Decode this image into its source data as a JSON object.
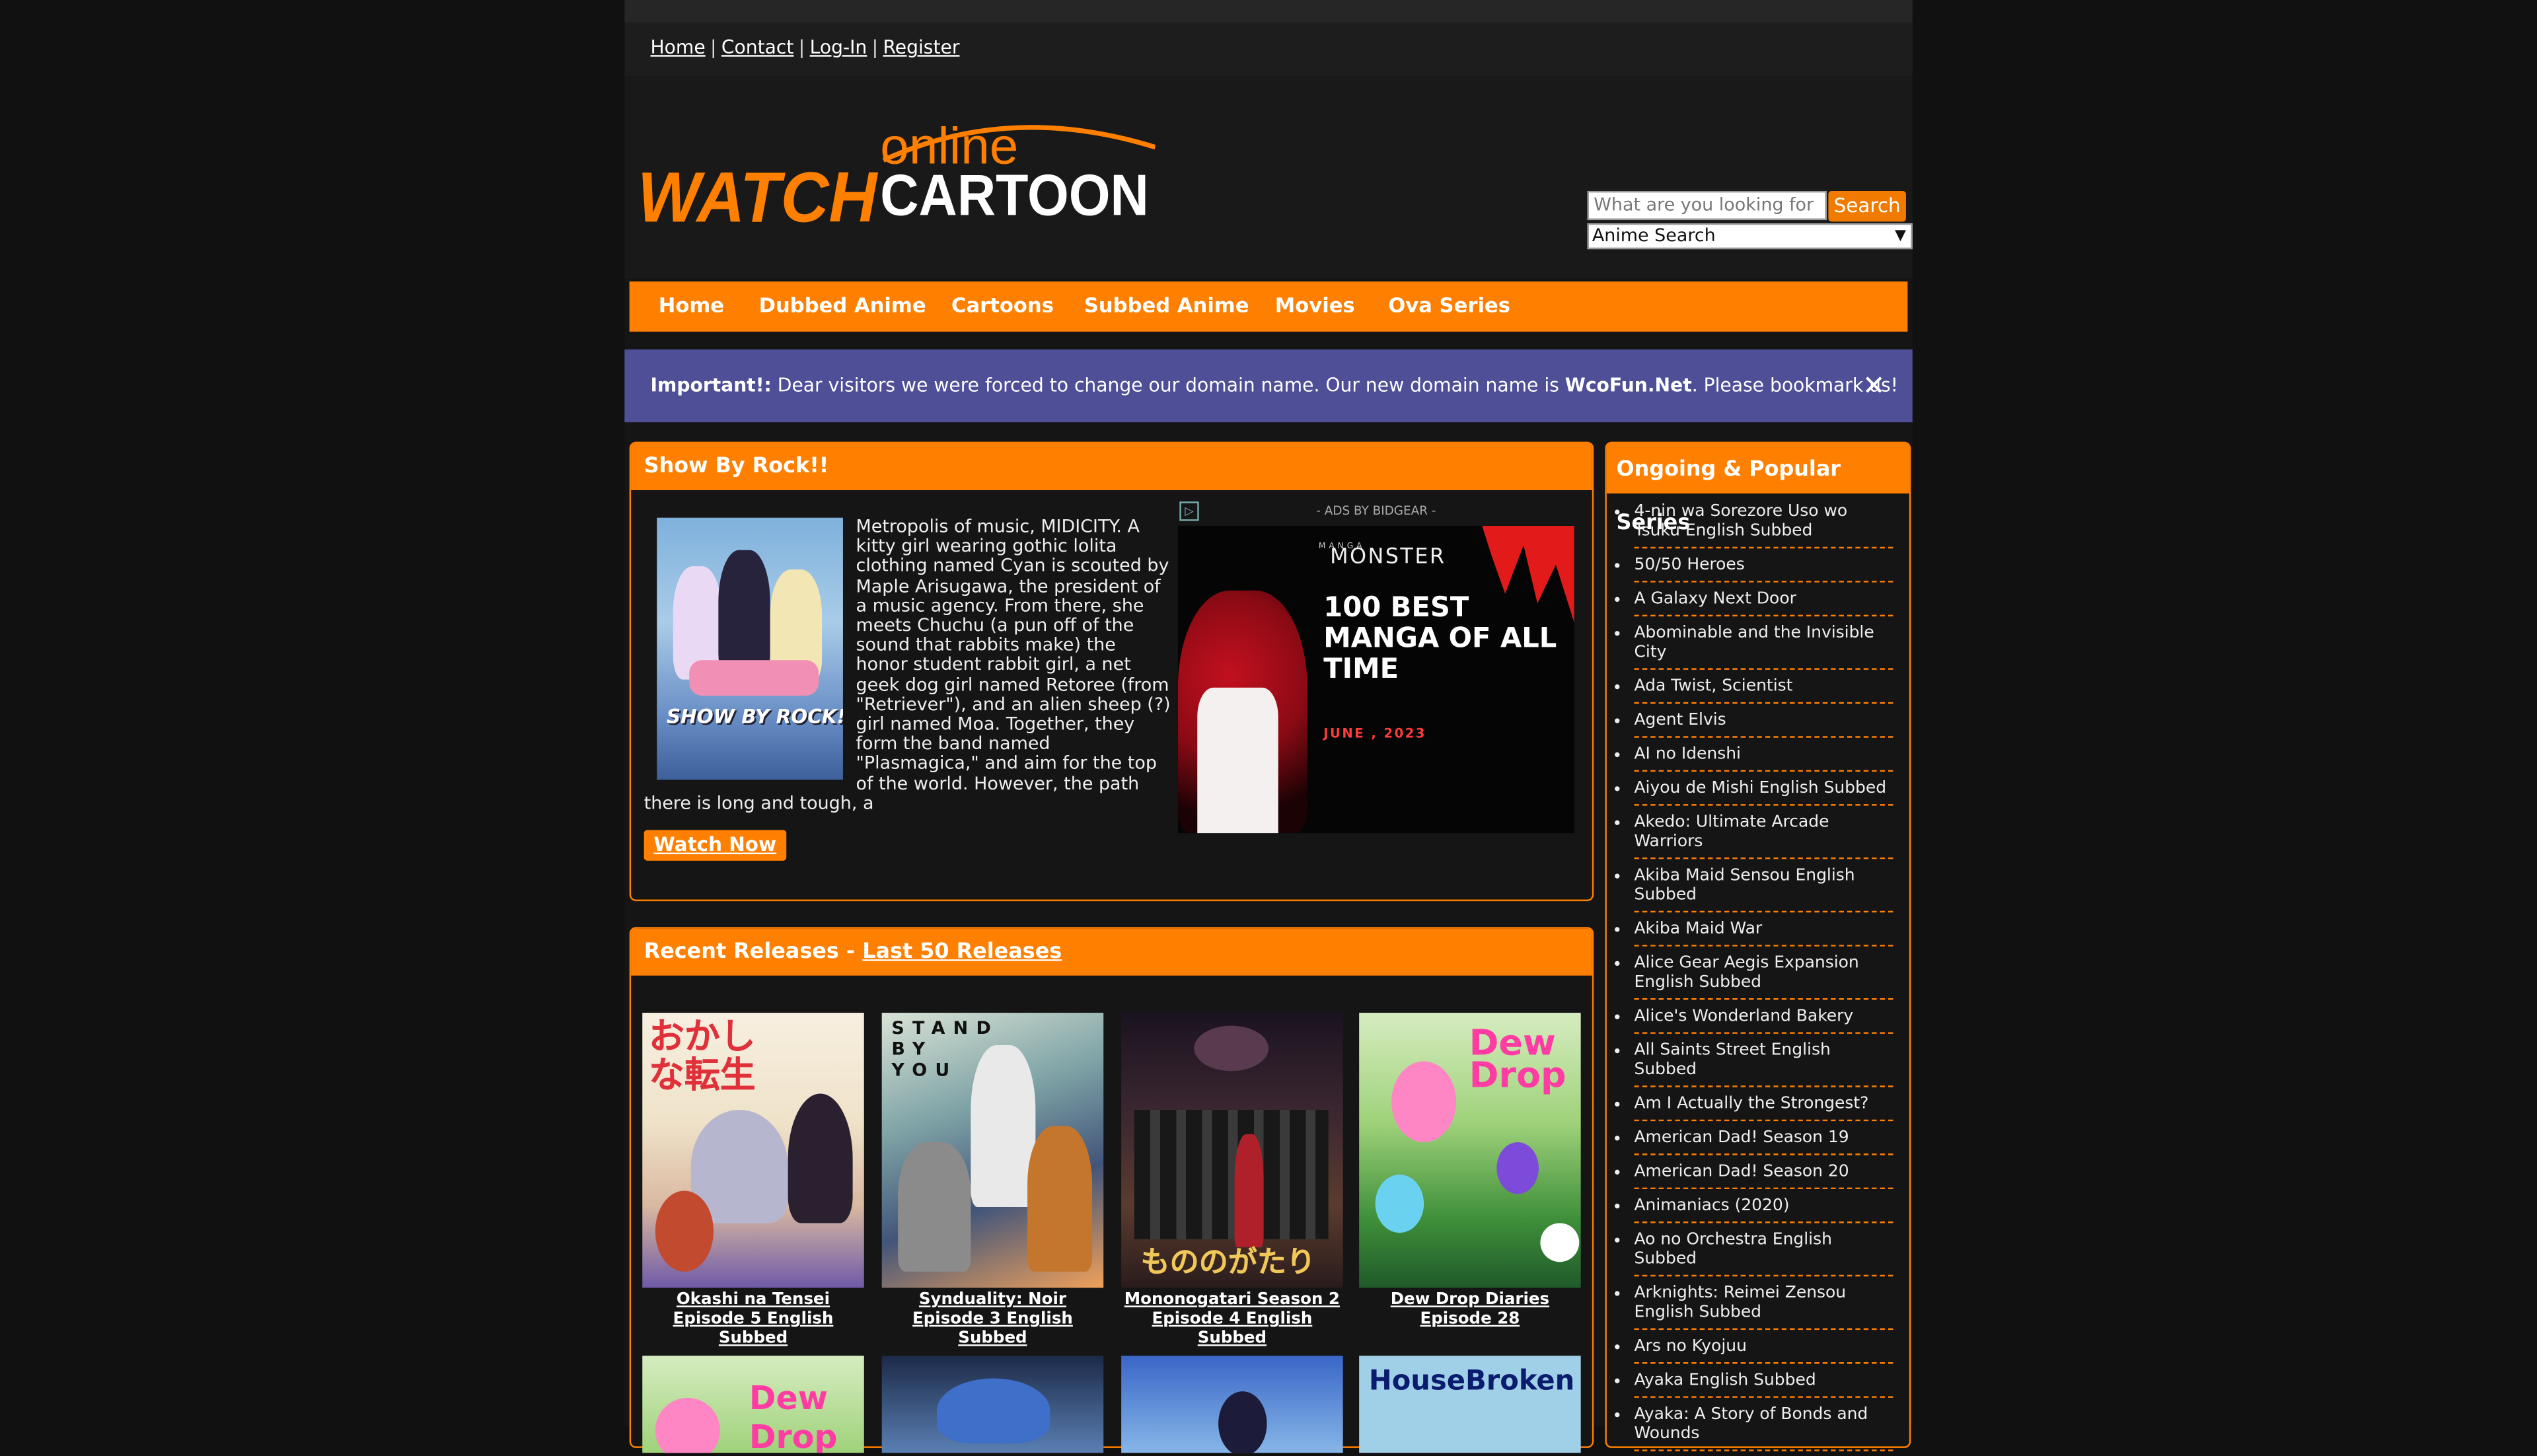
{
  "toplinks": {
    "home": "Home",
    "contact": "Contact",
    "login": "Log-In",
    "register": "Register",
    "sep": "|"
  },
  "logo": {
    "top": "online",
    "left": "WATCH",
    "right": "CARTOON"
  },
  "search": {
    "placeholder": "What are you looking for",
    "button": "Search",
    "select": "Anime Search"
  },
  "nav": [
    "Home",
    "Dubbed Anime",
    "Cartoons",
    "Subbed Anime",
    "Movies",
    "Ova Series"
  ],
  "notice": {
    "label": "Important!:",
    "text": " Dear visitors we were forced to change our domain name. Our new domain name is ",
    "domain": "WcoFun.Net",
    "tail": ". Please bookmark us!",
    "close": "✕"
  },
  "featured": {
    "title": "Show By Rock!!",
    "poster_label": "SHOW BY ROCK!!",
    "description": "Metropolis of music, MIDICITY. A kitty girl wearing gothic lolita clothing named Cyan is scouted by Maple Arisugawa, the president of a music agency. From there, she meets Chuchu (a pun off of the sound that rabbits make) the honor student rabbit girl, a net geek dog girl named Retoree (from \"Retriever\"), and an alien sheep (?) girl named Moa. Together, they form the band named \"Plasmagica,\" and aim for the top of the world. However, the path there is long and tough, a",
    "watch": "Watch Now"
  },
  "ad": {
    "label": "- ADS BY BIDGEAR -",
    "brand": "MONSTER",
    "brand_small": "MANGA",
    "headline": "100 BEST MANGA OF ALL TIME",
    "date": "JUNE , 2023"
  },
  "recent": {
    "title": "Recent Releases - ",
    "link": "Last 50 Releases",
    "items": [
      {
        "caption": "Okashi na Tensei Episode 5 English Subbed",
        "art": "おかしな転生"
      },
      {
        "caption": "Synduality: Noir Episode 3 English Subbed",
        "art": "STAND BY YOU"
      },
      {
        "caption": "Mononogatari Season 2 Episode 4 English Subbed",
        "art": "もののがたり"
      },
      {
        "caption": "Dew Drop Diaries Episode 28",
        "art": "Dew Drop"
      }
    ],
    "row2": [
      {
        "art": "Dew Drop"
      },
      {
        "art": ""
      },
      {
        "art": ""
      },
      {
        "art": "HouseBroken"
      }
    ]
  },
  "sidebar": {
    "title": "Ongoing & Popular Series",
    "items": [
      "4-nin wa Sorezore Uso wo Tsuku English Subbed",
      "50/50 Heroes",
      "A Galaxy Next Door",
      "Abominable and the Invisible City",
      "Ada Twist, Scientist",
      "Agent Elvis",
      "AI no Idenshi",
      "Aiyou de Mishi English Subbed",
      "Akedo: Ultimate Arcade Warriors",
      "Akiba Maid Sensou English Subbed",
      "Akiba Maid War",
      "Alice Gear Aegis Expansion English Subbed",
      "Alice's Wonderland Bakery",
      "All Saints Street English Subbed",
      "Am I Actually the Strongest?",
      "American Dad! Season 19",
      "American Dad! Season 20",
      "Animaniacs (2020)",
      "Ao no Orchestra English Subbed",
      "Arknights: Reimei Zensou English Subbed",
      "Ars no Kyojuu",
      "Ayaka English Subbed",
      "Ayaka: A Story of Bonds and Wounds"
    ]
  },
  "colors": {
    "accent": "#ff7f00",
    "notice_bg": "#4e4f96",
    "page_bg": "#111111"
  }
}
